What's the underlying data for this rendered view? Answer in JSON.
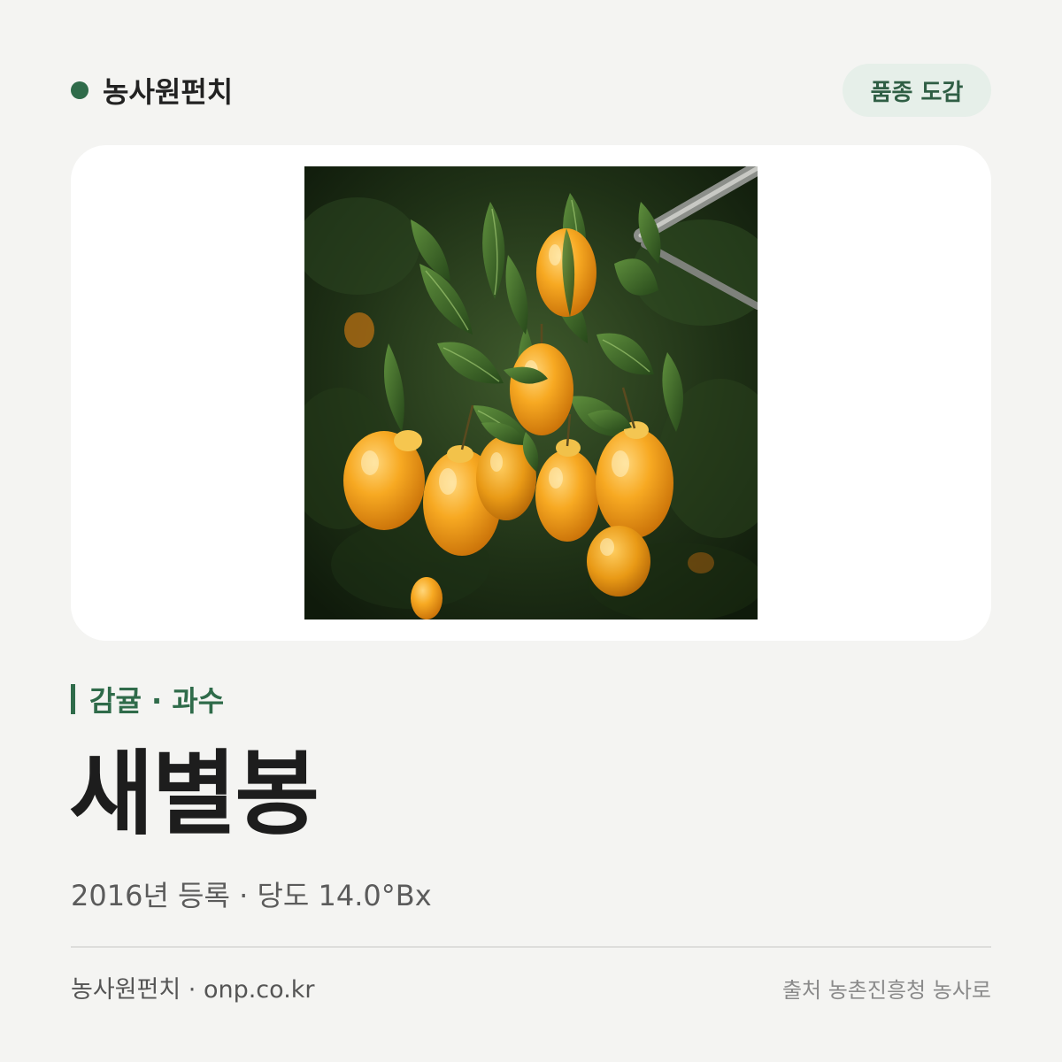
{
  "header": {
    "brand_name": "농사원펀치",
    "tag_label": "품종 도감"
  },
  "photo": {
    "subject": "citrus-fruits-photo"
  },
  "variety": {
    "category": "감귤 · 과수",
    "name": "새별봉",
    "details": "2016년 등록 · 당도 14.0°Bx"
  },
  "footer": {
    "left": "농사원펀치 · onp.co.kr",
    "right": "출처 농촌진흥청 농사로"
  },
  "colors": {
    "accent": "#2f6b4a",
    "pill_bg": "#e6efe9",
    "page_bg": "#f4f4f2",
    "card_bg": "#ffffff"
  }
}
